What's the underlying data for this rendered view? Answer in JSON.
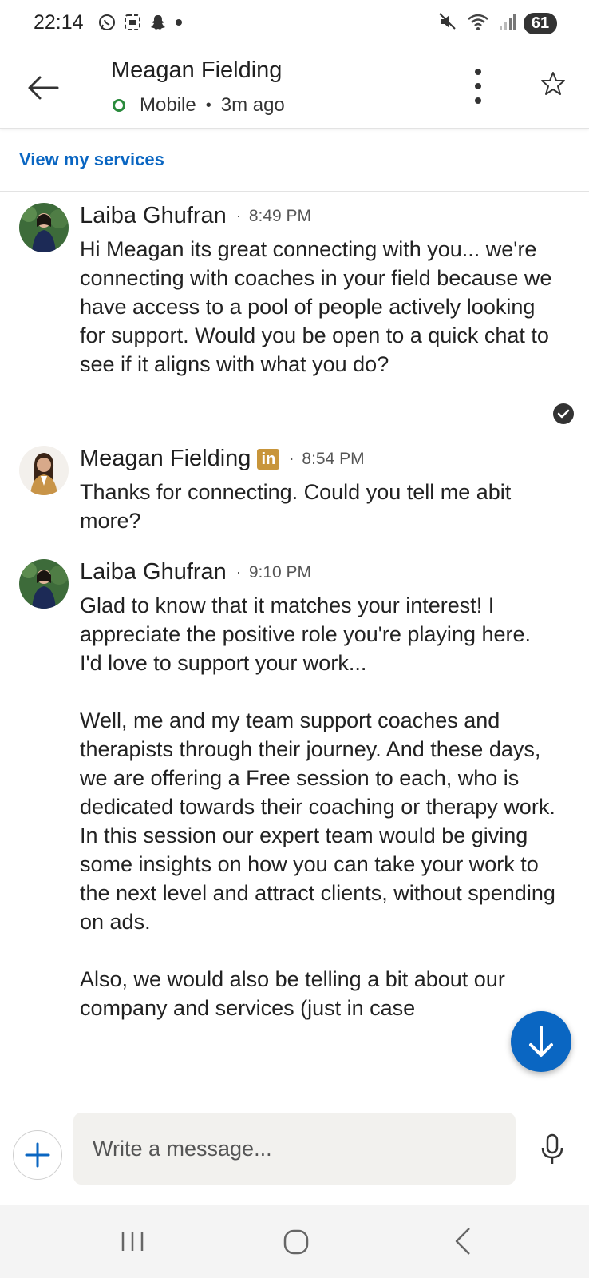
{
  "status_bar": {
    "time": "22:14",
    "battery": "61",
    "left_icons": [
      "whatsapp-icon",
      "screenshot-icon",
      "snapchat-icon",
      "dot-icon"
    ],
    "right_icons": [
      "mute-icon",
      "wifi-icon",
      "signal-icon"
    ]
  },
  "header": {
    "contact_name": "Meagan Fielding",
    "presence_device": "Mobile",
    "presence_sep": "•",
    "presence_time": "3m ago"
  },
  "services_link": "View my services",
  "messages": [
    {
      "sender": "Laiba Ghufran",
      "separator": "·",
      "time": "8:49 PM",
      "text": "Hi Meagan its great connecting with you... we're connecting with coaches in your field because we have access to a pool of people actively looking for support. Would you be open to a quick chat to see if it aligns with what you do?"
    },
    {
      "sender": "Meagan Fielding",
      "badge": "in",
      "separator": "·",
      "time": "8:54 PM",
      "text": "Thanks for connecting. Could you tell me abit more?"
    },
    {
      "sender": "Laiba Ghufran",
      "separator": "·",
      "time": "9:10 PM",
      "text": "Glad to know that it matches your interest! I appreciate the positive role you're playing here. I'd love to support your work...\n\nWell, me and my team support coaches and therapists through their journey. And these days, we are offering a Free session to each, who is dedicated towards their coaching or therapy work. In this session our expert team would be giving some insights on how you can take your work to the next level and attract clients, without spending on ads.\n\nAlso, we would also be telling a bit about our company and services (just in case"
    }
  ],
  "composer": {
    "placeholder": "Write a message..."
  },
  "colors": {
    "accent": "#0a66c2",
    "presence_green": "#2a8a3c",
    "linkedin_badge": "#c8953a"
  }
}
